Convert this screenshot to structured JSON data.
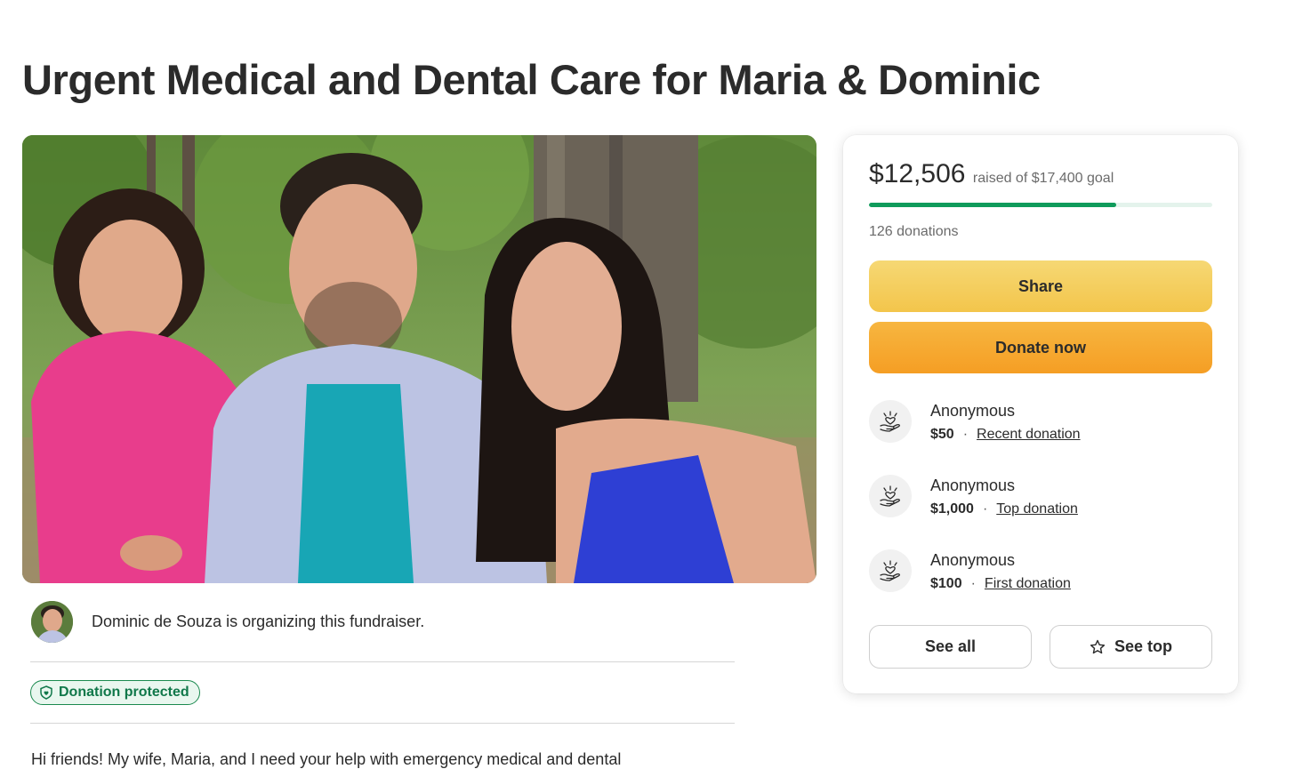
{
  "page": {
    "title": "Urgent Medical and Dental Care for Maria & Dominic"
  },
  "organizer": {
    "text": "Dominic de Souza is organizing this fundraiser."
  },
  "badge": {
    "label": "Donation protected",
    "color": "#10784a"
  },
  "story": {
    "preview": "Hi friends! My wife, Maria, and I need your help with emergency medical and dental"
  },
  "summary": {
    "raised": "$12,506",
    "raised_of": "raised of $17,400 goal",
    "progress_fraction": 0.719,
    "donations_count": "126 donations",
    "progress_color": "#0f9b5b"
  },
  "actions": {
    "share_label": "Share",
    "donate_label": "Donate now"
  },
  "donations": [
    {
      "name": "Anonymous",
      "amount": "$50",
      "tag": "Recent donation",
      "icon": "heart-hand-icon"
    },
    {
      "name": "Anonymous",
      "amount": "$1,000",
      "tag": "Top donation",
      "icon": "heart-hand-icon"
    },
    {
      "name": "Anonymous",
      "amount": "$100",
      "tag": "First donation",
      "icon": "heart-hand-icon"
    }
  ],
  "footer_buttons": {
    "see_all_label": "See all",
    "see_top_label": "See top",
    "see_top_icon": "star-icon"
  }
}
